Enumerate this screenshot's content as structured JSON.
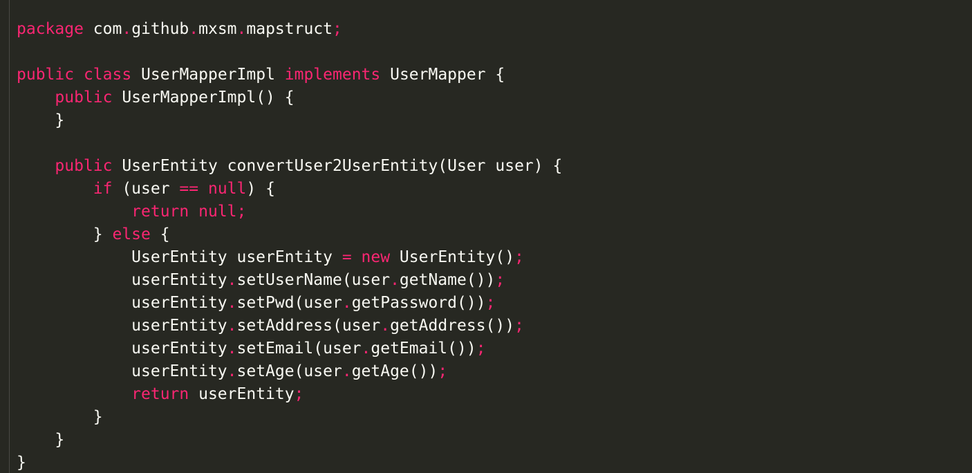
{
  "editor": {
    "colors": {
      "background": "#272822",
      "keyword": "#f92672",
      "text": "#f8f8f2",
      "gutter": "#4a4a45"
    },
    "lines": [
      [
        [
          "kw",
          "package"
        ],
        [
          "tx",
          " com"
        ],
        [
          "pn",
          "."
        ],
        [
          "tx",
          "github"
        ],
        [
          "pn",
          "."
        ],
        [
          "tx",
          "mxsm"
        ],
        [
          "pn",
          "."
        ],
        [
          "tx",
          "mapstruct"
        ],
        [
          "pn",
          ";"
        ]
      ],
      [],
      [
        [
          "kw",
          "public"
        ],
        [
          "tx",
          " "
        ],
        [
          "kw",
          "class"
        ],
        [
          "tx",
          " UserMapperImpl "
        ],
        [
          "kw",
          "implements"
        ],
        [
          "tx",
          " UserMapper {"
        ]
      ],
      [
        [
          "tx",
          "    "
        ],
        [
          "kw",
          "public"
        ],
        [
          "tx",
          " UserMapperImpl() {"
        ]
      ],
      [
        [
          "tx",
          "    }"
        ]
      ],
      [],
      [
        [
          "tx",
          "    "
        ],
        [
          "kw",
          "public"
        ],
        [
          "tx",
          " UserEntity convertUser2UserEntity(User user) {"
        ]
      ],
      [
        [
          "tx",
          "        "
        ],
        [
          "kw",
          "if"
        ],
        [
          "tx",
          " (user "
        ],
        [
          "kw",
          "=="
        ],
        [
          "tx",
          " "
        ],
        [
          "kw",
          "null"
        ],
        [
          "tx",
          ") {"
        ]
      ],
      [
        [
          "tx",
          "            "
        ],
        [
          "kw",
          "return"
        ],
        [
          "tx",
          " "
        ],
        [
          "kw",
          "null"
        ],
        [
          "pn",
          ";"
        ]
      ],
      [
        [
          "tx",
          "        } "
        ],
        [
          "kw",
          "else"
        ],
        [
          "tx",
          " {"
        ]
      ],
      [
        [
          "tx",
          "            UserEntity userEntity "
        ],
        [
          "kw",
          "="
        ],
        [
          "tx",
          " "
        ],
        [
          "kw",
          "new"
        ],
        [
          "tx",
          " UserEntity()"
        ],
        [
          "pn",
          ";"
        ]
      ],
      [
        [
          "tx",
          "            userEntity"
        ],
        [
          "pn",
          "."
        ],
        [
          "tx",
          "setUserName(user"
        ],
        [
          "pn",
          "."
        ],
        [
          "tx",
          "getName())"
        ],
        [
          "pn",
          ";"
        ]
      ],
      [
        [
          "tx",
          "            userEntity"
        ],
        [
          "pn",
          "."
        ],
        [
          "tx",
          "setPwd(user"
        ],
        [
          "pn",
          "."
        ],
        [
          "tx",
          "getPassword())"
        ],
        [
          "pn",
          ";"
        ]
      ],
      [
        [
          "tx",
          "            userEntity"
        ],
        [
          "pn",
          "."
        ],
        [
          "tx",
          "setAddress(user"
        ],
        [
          "pn",
          "."
        ],
        [
          "tx",
          "getAddress())"
        ],
        [
          "pn",
          ";"
        ]
      ],
      [
        [
          "tx",
          "            userEntity"
        ],
        [
          "pn",
          "."
        ],
        [
          "tx",
          "setEmail(user"
        ],
        [
          "pn",
          "."
        ],
        [
          "tx",
          "getEmail())"
        ],
        [
          "pn",
          ";"
        ]
      ],
      [
        [
          "tx",
          "            userEntity"
        ],
        [
          "pn",
          "."
        ],
        [
          "tx",
          "setAge(user"
        ],
        [
          "pn",
          "."
        ],
        [
          "tx",
          "getAge())"
        ],
        [
          "pn",
          ";"
        ]
      ],
      [
        [
          "tx",
          "            "
        ],
        [
          "kw",
          "return"
        ],
        [
          "tx",
          " userEntity"
        ],
        [
          "pn",
          ";"
        ]
      ],
      [
        [
          "tx",
          "        }"
        ]
      ],
      [
        [
          "tx",
          "    }"
        ]
      ],
      [
        [
          "tx",
          "}"
        ]
      ]
    ]
  }
}
